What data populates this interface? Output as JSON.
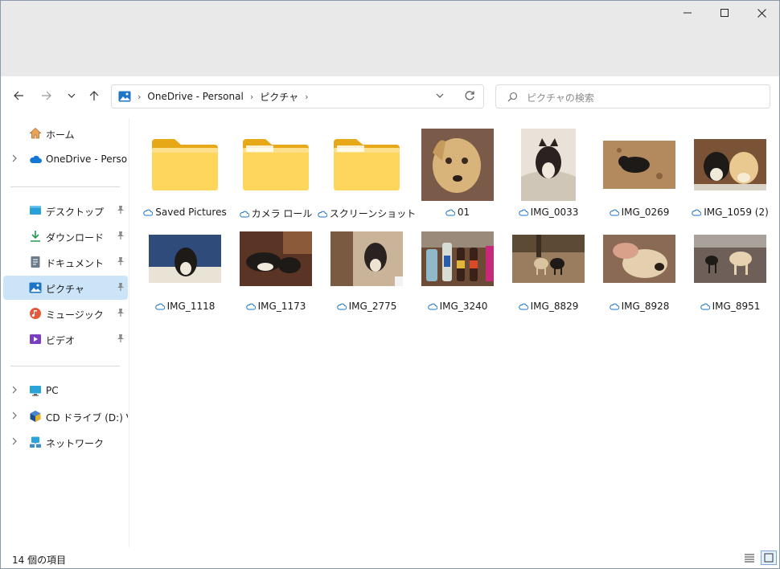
{
  "window": {
    "minimize_icon": "minimize-icon",
    "maximize_icon": "maximize-icon",
    "close_icon": "close-icon"
  },
  "toolbar": {
    "address": [
      "OneDrive - Personal",
      "ピクチャ"
    ],
    "search_placeholder": "ピクチャの検索"
  },
  "sidebar": {
    "quick": [
      {
        "label": "ホーム",
        "icon": "home-icon"
      },
      {
        "label": "OneDrive - Personal",
        "icon": "cloud-icon"
      }
    ],
    "pinned": [
      {
        "label": "デスクトップ",
        "icon": "desktop-icon"
      },
      {
        "label": "ダウンロード",
        "icon": "download-icon"
      },
      {
        "label": "ドキュメント",
        "icon": "document-icon"
      },
      {
        "label": "ピクチャ",
        "icon": "pictures-icon",
        "selected": true
      },
      {
        "label": "ミュージック",
        "icon": "music-icon"
      },
      {
        "label": "ビデオ",
        "icon": "video-icon"
      }
    ],
    "devices": [
      {
        "label": "PC",
        "icon": "pc-icon"
      },
      {
        "label": "CD ドライブ (D:) VirtualBox Guest Additions",
        "icon": "cd-drive-icon"
      },
      {
        "label": "ネットワーク",
        "icon": "network-icon"
      }
    ]
  },
  "files": [
    {
      "name": "Saved Pictures",
      "kind": "folder"
    },
    {
      "name": "カメラ ロール",
      "kind": "folder"
    },
    {
      "name": "スクリーンショット",
      "kind": "folder"
    },
    {
      "name": "01",
      "kind": "photo"
    },
    {
      "name": "IMG_0033",
      "kind": "photo"
    },
    {
      "name": "IMG_0269",
      "kind": "photo"
    },
    {
      "name": "IMG_1059 (2)",
      "kind": "photo"
    },
    {
      "name": "IMG_1118",
      "kind": "photo"
    },
    {
      "name": "IMG_1173",
      "kind": "photo"
    },
    {
      "name": "IMG_2775",
      "kind": "photo"
    },
    {
      "name": "IMG_3240",
      "kind": "photo"
    },
    {
      "name": "IMG_8829",
      "kind": "photo"
    },
    {
      "name": "IMG_8928",
      "kind": "photo"
    },
    {
      "name": "IMG_8951",
      "kind": "photo"
    }
  ],
  "status": {
    "item_count": "14 個の項目"
  },
  "colors": {
    "accent": "#0067c0",
    "selected_bg": "#cce4f7",
    "folder": "#f7c94a",
    "cloud_status": "#1a73c7"
  }
}
